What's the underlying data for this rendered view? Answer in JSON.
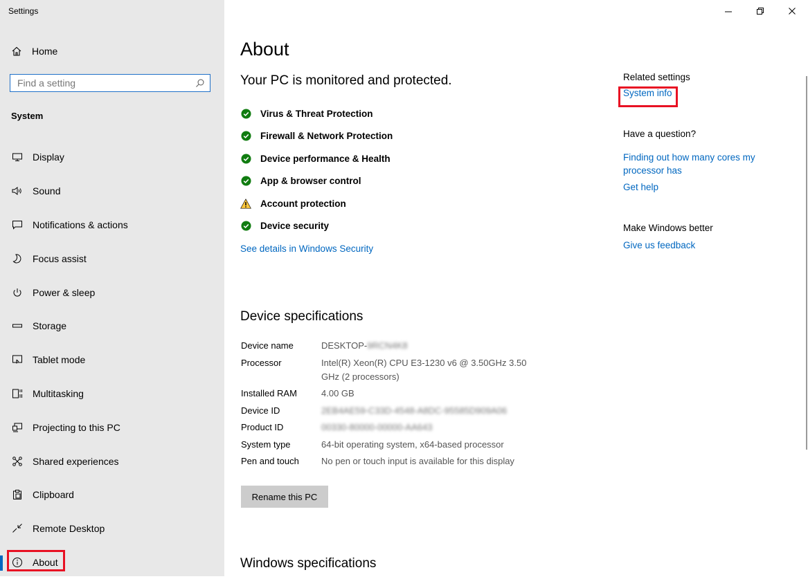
{
  "window": {
    "title": "Settings",
    "controls": [
      "minimize",
      "restore",
      "close"
    ]
  },
  "sidebar": {
    "home_label": "Home",
    "search_placeholder": "Find a setting",
    "section_label": "System",
    "items": [
      {
        "label": "Display",
        "icon": "display-icon"
      },
      {
        "label": "Sound",
        "icon": "sound-icon"
      },
      {
        "label": "Notifications & actions",
        "icon": "notifications-icon"
      },
      {
        "label": "Focus assist",
        "icon": "moon-icon"
      },
      {
        "label": "Power & sleep",
        "icon": "power-icon"
      },
      {
        "label": "Storage",
        "icon": "storage-icon"
      },
      {
        "label": "Tablet mode",
        "icon": "tablet-mode-icon"
      },
      {
        "label": "Multitasking",
        "icon": "multitasking-icon"
      },
      {
        "label": "Projecting to this PC",
        "icon": "projecting-icon"
      },
      {
        "label": "Shared experiences",
        "icon": "shared-experiences-icon"
      },
      {
        "label": "Clipboard",
        "icon": "clipboard-icon"
      },
      {
        "label": "Remote Desktop",
        "icon": "remote-desktop-icon"
      },
      {
        "label": "About",
        "icon": "info-icon",
        "active": true
      }
    ]
  },
  "main": {
    "title": "About",
    "protection": {
      "heading": "Your PC is monitored and protected.",
      "items": [
        {
          "label": "Virus & Threat Protection",
          "status": "ok"
        },
        {
          "label": "Firewall & Network Protection",
          "status": "ok"
        },
        {
          "label": "Device performance & Health",
          "status": "ok"
        },
        {
          "label": "App & browser control",
          "status": "ok"
        },
        {
          "label": "Account protection",
          "status": "warning"
        },
        {
          "label": "Device security",
          "status": "ok"
        }
      ],
      "details_link": "See details in Windows Security"
    },
    "device_specs": {
      "heading": "Device specifications",
      "rows": [
        {
          "key": "Device name",
          "value": "DESKTOP-",
          "blurred_suffix": "9RCN4K8"
        },
        {
          "key": "Processor",
          "value": "Intel(R) Xeon(R) CPU E3-1230 v6 @ 3.50GHz   3.50 GHz  (2 processors)"
        },
        {
          "key": "Installed RAM",
          "value": "4.00 GB"
        },
        {
          "key": "Device ID",
          "value": "",
          "blurred_suffix": "2EB4AE59-C33D-4548-A8DC-95585D909A06"
        },
        {
          "key": "Product ID",
          "value": "",
          "blurred_suffix": "00330-80000-00000-AA643"
        },
        {
          "key": "System type",
          "value": "64-bit operating system, x64-based processor"
        },
        {
          "key": "Pen and touch",
          "value": "No pen or touch input is available for this display"
        }
      ],
      "rename_button": "Rename this PC"
    },
    "windows_specs_heading": "Windows specifications"
  },
  "related": {
    "related_heading": "Related settings",
    "system_info_link": "System info",
    "question_heading": "Have a question?",
    "cores_link": "Finding out how many cores my processor has",
    "help_link": "Get help",
    "better_heading": "Make Windows better",
    "feedback_link": "Give us feedback"
  },
  "colors": {
    "accent": "#0067c0",
    "ok": "#107c10",
    "warning": "#ffc83d",
    "highlight": "#e81123",
    "sidebar_bg": "#e8e8e8"
  }
}
